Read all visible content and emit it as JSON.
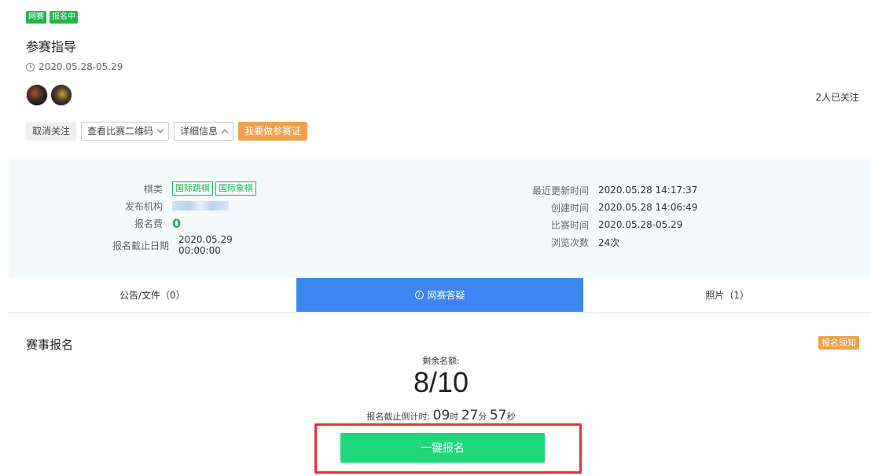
{
  "header": {
    "tags": [
      "网赛",
      "报名中"
    ],
    "title": "参赛指导",
    "date": "2020.05.28-05.29",
    "followers": "2人已关注"
  },
  "actions": {
    "unfollow": "取消关注",
    "qrcode": "查看比赛二维码",
    "details": "详细信息",
    "make_pass": "我要做参赛证"
  },
  "info": {
    "category_label": "棋类",
    "categories": [
      "国际跳棋",
      "国际象棋"
    ],
    "publisher_label": "发布机构",
    "fee_label": "报名费",
    "fee_value": "0",
    "deadline_label": "报名截止日期",
    "deadline_value": "2020.05.29 00:00:00",
    "updated_label": "最近更新时间",
    "updated_value": "2020.05.28 14:17:37",
    "created_label": "创建时间",
    "created_value": "2020.05.28 14:06:49",
    "match_time_label": "比赛时间",
    "match_time_value": "2020.05.28-05.29",
    "views_label": "浏览次数",
    "views_value": "24次"
  },
  "tabs": [
    {
      "label": "公告/文件（0）",
      "active": false
    },
    {
      "label": "网赛答疑",
      "active": true
    },
    {
      "label": "照片（1）",
      "active": false
    }
  ],
  "registration": {
    "title": "赛事报名",
    "notice": "报名须知",
    "remaining_label": "剩余名额:",
    "remaining_value": "8/10",
    "countdown_label": "报名截止倒计时:",
    "hours": "09",
    "hours_unit": "时",
    "minutes": "27",
    "minutes_unit": "分",
    "seconds": "57",
    "seconds_unit": "秒",
    "signup_button": "一键报名"
  },
  "colors": {
    "green": "#21b54c",
    "blue_tab": "#3d86f0",
    "orange": "#f0a04b",
    "signup_green": "#1fd87a",
    "highlight_red": "#e53030"
  }
}
